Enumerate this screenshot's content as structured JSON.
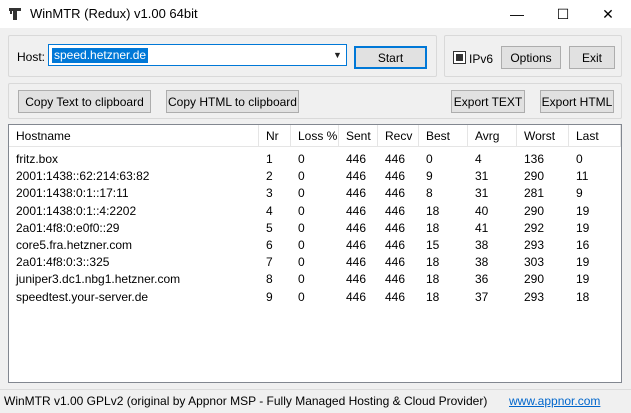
{
  "window": {
    "title": "WinMTR (Redux) v1.00 64bit",
    "controls": {
      "minimize": "—",
      "maximize": "☐",
      "close": "✕"
    }
  },
  "host": {
    "label": "Host:",
    "value": "speed.hetzner.de",
    "start_label": "Start"
  },
  "options": {
    "ipv6_label": "IPv6",
    "ipv6_checked": true,
    "options_label": "Options",
    "exit_label": "Exit"
  },
  "toolbar": {
    "copy_text": "Copy Text to clipboard",
    "copy_html": "Copy HTML to clipboard",
    "export_text": "Export TEXT",
    "export_html": "Export HTML"
  },
  "table": {
    "columns": [
      "Hostname",
      "Nr",
      "Loss %",
      "Sent",
      "Recv",
      "Best",
      "Avrg",
      "Worst",
      "Last"
    ],
    "rows": [
      [
        "fritz.box",
        "1",
        "0",
        "446",
        "446",
        "0",
        "4",
        "136",
        "0"
      ],
      [
        "2001:1438::62:214:63:82",
        "2",
        "0",
        "446",
        "446",
        "9",
        "31",
        "290",
        "11"
      ],
      [
        "2001:1438:0:1::17:11",
        "3",
        "0",
        "446",
        "446",
        "8",
        "31",
        "281",
        "9"
      ],
      [
        "2001:1438:0:1::4:2202",
        "4",
        "0",
        "446",
        "446",
        "18",
        "40",
        "290",
        "19"
      ],
      [
        "2a01:4f8:0:e0f0::29",
        "5",
        "0",
        "446",
        "446",
        "18",
        "41",
        "292",
        "19"
      ],
      [
        "core5.fra.hetzner.com",
        "6",
        "0",
        "446",
        "446",
        "15",
        "38",
        "293",
        "16"
      ],
      [
        "2a01:4f8:0:3::325",
        "7",
        "0",
        "446",
        "446",
        "18",
        "38",
        "303",
        "19"
      ],
      [
        "juniper3.dc1.nbg1.hetzner.com",
        "8",
        "0",
        "446",
        "446",
        "18",
        "36",
        "290",
        "19"
      ],
      [
        "speedtest.your-server.de",
        "9",
        "0",
        "446",
        "446",
        "18",
        "37",
        "293",
        "18"
      ]
    ]
  },
  "status": {
    "text": "WinMTR v1.00 GPLv2 (original by Appnor MSP - Fully Managed Hosting & Cloud Provider)",
    "link": "www.appnor.com"
  }
}
